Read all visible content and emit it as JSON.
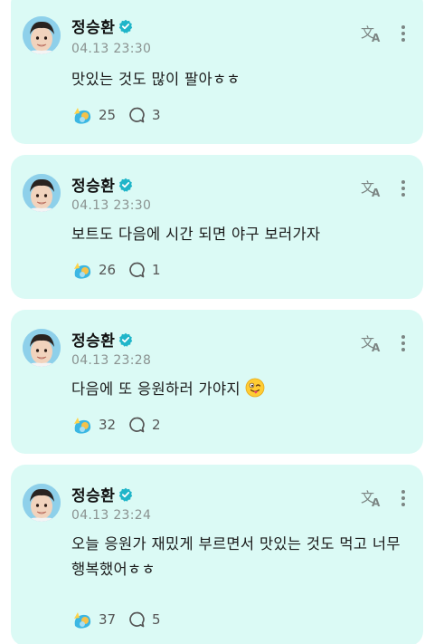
{
  "posts": [
    {
      "author": "정승환",
      "time": "04.13 23:30",
      "text": "맛있는 것도 많이 팔아ㅎㅎ",
      "reactions": "25",
      "comments": "3"
    },
    {
      "author": "정승환",
      "time": "04.13 23:30",
      "text": "보트도 다음에 시간 되면 야구 보러가자",
      "reactions": "26",
      "comments": "1"
    },
    {
      "author": "정승환",
      "time": "04.13 23:28",
      "text": "다음에 또 응원하러 가야지",
      "emoji": "winking-face-with-tongue",
      "reactions": "32",
      "comments": "2"
    },
    {
      "author": "정승환",
      "time": "04.13 23:24",
      "text": "오늘 응원가 재밌게 부르면서 맛있는 것도 먹고 너무 행복했어ㅎㅎ",
      "reactions": "37",
      "comments": "5"
    }
  ],
  "colors": {
    "card_bg": "#dbfaf5",
    "verified": "#1fb5c9",
    "icon_gray": "#7c8583",
    "timestamp": "#8a9290"
  },
  "icons": {
    "verified": "verified-check-icon",
    "translate": "translate-icon",
    "more": "more-vertical-icon",
    "reaction": "cheer-reaction-icon",
    "comment": "comment-bubble-icon"
  }
}
